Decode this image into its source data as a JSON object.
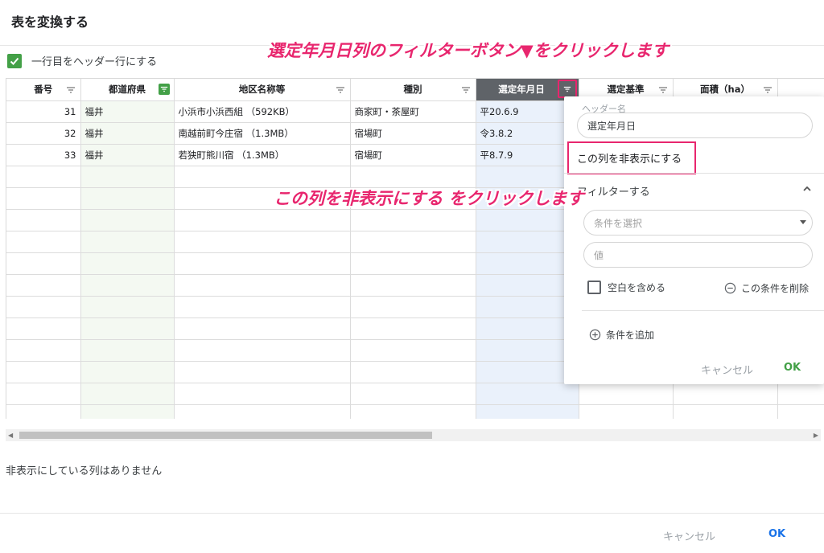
{
  "dialog": {
    "title": "表を変換する"
  },
  "header_row_option": {
    "label": "一行目をヘッダー行にする",
    "checked": true
  },
  "columns": [
    {
      "label": "番号"
    },
    {
      "label": "都道府県"
    },
    {
      "label": "地区名称等"
    },
    {
      "label": "種別"
    },
    {
      "label": "選定年月日"
    },
    {
      "label": "選定基準"
    },
    {
      "label": "面積（ha）"
    },
    {
      "label": ""
    }
  ],
  "rows": [
    [
      "31",
      "福井",
      "小浜市小浜西組 （592KB）",
      "商家町・茶屋町",
      "平20.6.9"
    ],
    [
      "32",
      "福井",
      "南越前町今庄宿 （1.3MB）",
      "宿場町",
      "令3.8.2"
    ],
    [
      "33",
      "福井",
      "若狭町熊川宿 （1.3MB）",
      "宿場町",
      "平8.7.9"
    ]
  ],
  "popup": {
    "header_name_label": "ヘッダー名",
    "header_name_value": "選定年月日",
    "hide_column": "この列を非表示にする",
    "filter_section": "フィルターする",
    "condition_placeholder": "条件を選択",
    "value_placeholder": "値",
    "include_blank": "空白を含める",
    "delete_condition": "この条件を削除",
    "add_condition": "条件を追加",
    "cancel": "キャンセル",
    "ok": "OK"
  },
  "hidden_columns_message": "非表示にしている列はありません",
  "footer": {
    "cancel": "キャンセル",
    "ok": "OK"
  },
  "annotations": {
    "step1": "選定年月日列のフィルターボタン▼をクリックします",
    "step2": "この列を非表示にする をクリックします"
  },
  "colors": {
    "accent_pink": "#e8266e",
    "green": "#43a047",
    "blue": "#1a73e8"
  }
}
